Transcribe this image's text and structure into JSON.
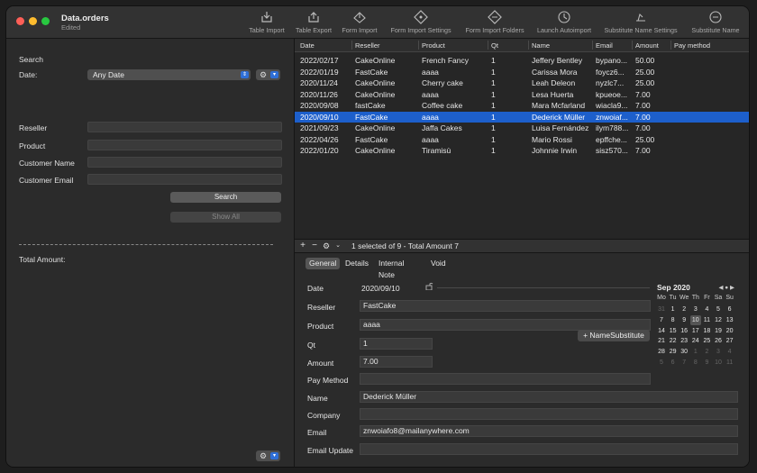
{
  "window": {
    "title": "Data.orders",
    "subtitle": "Edited"
  },
  "toolbar": [
    {
      "label": "Table Import",
      "icon": "table-import-icon"
    },
    {
      "label": "Table Export",
      "icon": "table-export-icon"
    },
    {
      "label": "Form Import",
      "icon": "form-import-icon"
    },
    {
      "label": "Form Import Settings",
      "icon": "form-import-settings-icon"
    },
    {
      "label": "Form Import Folders",
      "icon": "form-import-folders-icon"
    },
    {
      "label": "Launch Autoimport",
      "icon": "launch-autoimport-icon"
    },
    {
      "label": "Substitute Name Settings",
      "icon": "substitute-name-settings-icon"
    },
    {
      "label": "Substitute Name",
      "icon": "substitute-name-icon"
    }
  ],
  "search": {
    "heading": "Search",
    "date_label": "Date:",
    "date_value": "Any Date",
    "reseller_label": "Reseller",
    "product_label": "Product",
    "customer_name_label": "Customer Name",
    "customer_email_label": "Customer Email",
    "search_button": "Search",
    "show_all_button": "Show All",
    "total_amount_label": "Total Amount:"
  },
  "table": {
    "columns": [
      "Date",
      "Reseller",
      "Product",
      "Qt",
      "Name",
      "Email",
      "Amount",
      "Pay method"
    ],
    "rows": [
      [
        "2022/02/17",
        "CakeOnline",
        "French Fancy",
        "1",
        "Jeffery Bentley",
        "bypano...",
        "50.00",
        ""
      ],
      [
        "2022/01/19",
        "FastCake",
        "aaaa",
        "1",
        "Carissa Mora",
        "foycz6...",
        "25.00",
        ""
      ],
      [
        "2020/11/24",
        "CakeOnline",
        "Cherry cake",
        "1",
        "Leah Deleon",
        "nyzlc7...",
        "25.00",
        ""
      ],
      [
        "2020/11/26",
        "CakeOnline",
        "aaaa",
        "1",
        "Lesa Huerta",
        "kpueoe...",
        "7.00",
        ""
      ],
      [
        "2020/09/08",
        "fastCake",
        "Coffee cake",
        "1",
        "Mara Mcfarland",
        "wiacla9...",
        "7.00",
        ""
      ],
      [
        "2020/09/10",
        "FastCake",
        "aaaa",
        "1",
        "Dederick Müller",
        "znwoiaf...",
        "7.00",
        ""
      ],
      [
        "2021/09/23",
        "CakeOnline",
        "Jaffa Cakes",
        "1",
        "Luisa Fernández",
        "ilym788...",
        "7.00",
        ""
      ],
      [
        "2022/04/26",
        "FastCake",
        "aaaa",
        "1",
        "Mario Rossi",
        "epffche...",
        "25.00",
        ""
      ],
      [
        "2022/01/20",
        "CakeOnline",
        "Tiramisù",
        "1",
        "Johnnie Irwin",
        "sisz570...",
        "7.00",
        ""
      ]
    ],
    "selected_index": 5,
    "status": "1 selected of 9 - Total Amount 7"
  },
  "tabs": [
    "General",
    "Details",
    "Internal Note",
    "Void"
  ],
  "detail": {
    "date_label": "Date",
    "date_value": "2020/09/10",
    "reseller_label": "Reseller",
    "reseller_value": "FastCake",
    "product_label": "Product",
    "product_value": "aaaa",
    "qt_label": "Qt",
    "qt_value": "1",
    "amount_label": "Amount",
    "amount_value": "7.00",
    "pay_method_label": "Pay Method",
    "pay_method_value": "",
    "name_label": "Name",
    "name_value": "Dederick Müller",
    "company_label": "Company",
    "company_value": "",
    "email_label": "Email",
    "email_value": "znwoiafo8@mailanywhere.com",
    "email_update_label": "Email Update",
    "email_update_value": "",
    "name_substitute_button": "+ NameSubstitute"
  },
  "calendar": {
    "title": "Sep 2020",
    "dow": [
      "Mo",
      "Tu",
      "We",
      "Th",
      "Fr",
      "Sa",
      "Su"
    ],
    "days": [
      [
        "31",
        "1",
        "2",
        "3",
        "4",
        "5",
        "6"
      ],
      [
        "7",
        "8",
        "9",
        "10",
        "11",
        "12",
        "13"
      ],
      [
        "14",
        "15",
        "16",
        "17",
        "18",
        "19",
        "20"
      ],
      [
        "21",
        "22",
        "23",
        "24",
        "25",
        "26",
        "27"
      ],
      [
        "28",
        "29",
        "30",
        "1",
        "2",
        "3",
        "4"
      ],
      [
        "5",
        "6",
        "7",
        "8",
        "9",
        "10",
        "11"
      ]
    ],
    "selected": "10"
  },
  "colors": {
    "selection": "#1d5fcb",
    "accent": "#2f6fd6"
  }
}
